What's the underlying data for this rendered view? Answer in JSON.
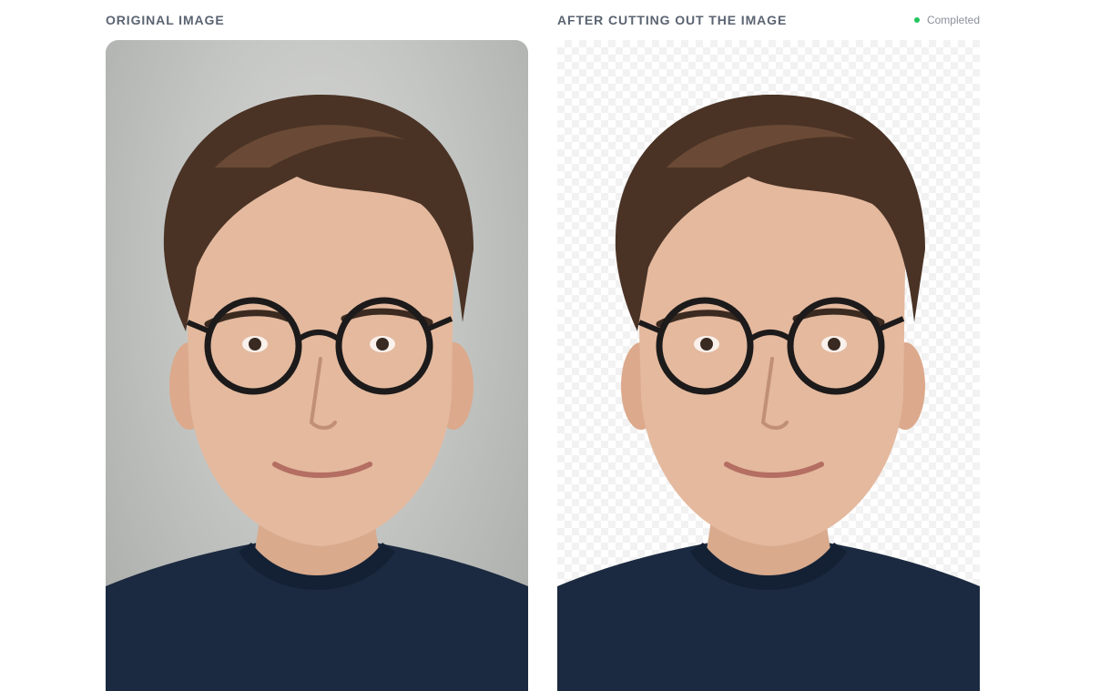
{
  "left_panel": {
    "title": "ORIGINAL IMAGE"
  },
  "right_panel": {
    "title": "AFTER CUTTING OUT THE IMAGE",
    "status": "Completed",
    "status_color": "#22c55e"
  },
  "colors": {
    "title_text": "#5b6472",
    "status_text": "#8a909a",
    "shirt": "#1b2a40",
    "hair": "#4a3325",
    "skin": "#e2b79c"
  }
}
